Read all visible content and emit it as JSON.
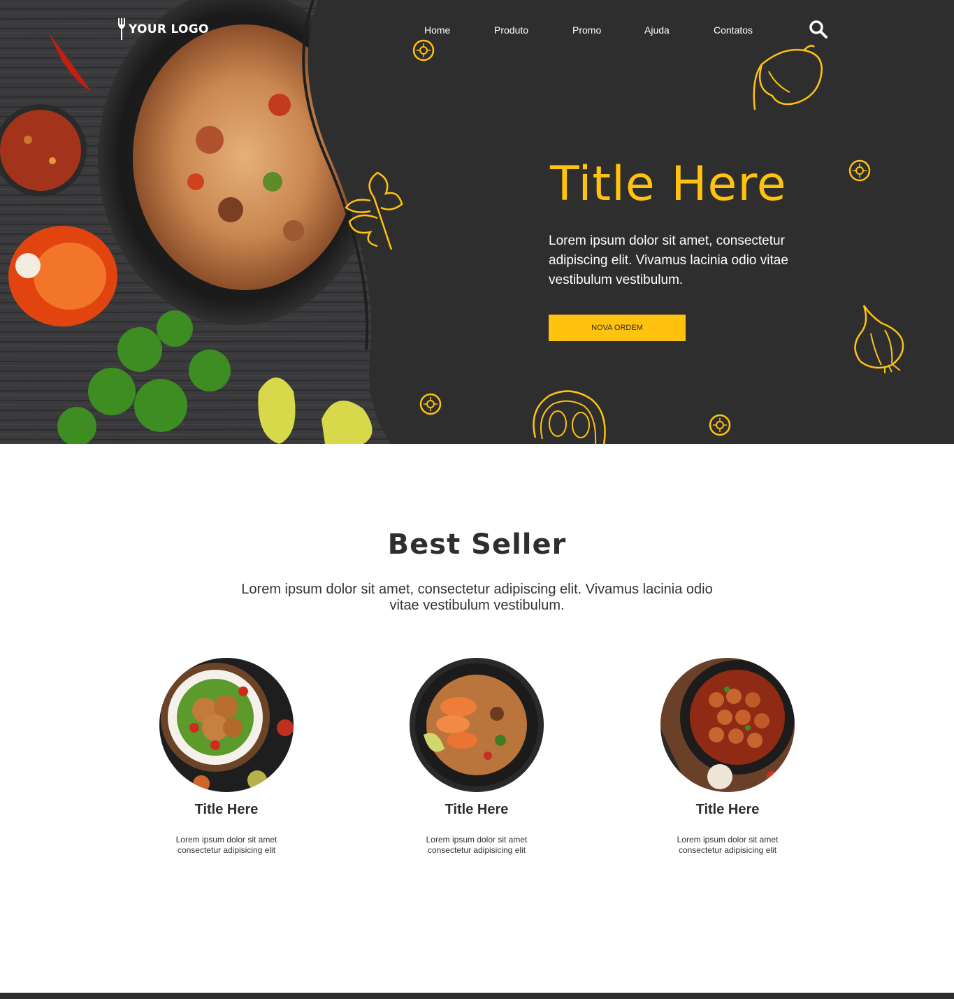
{
  "brand": {
    "logo_text": "YOUR LOGO",
    "accent": "#ffc20e",
    "dark": "#2e2e2e"
  },
  "nav": {
    "items": [
      "Home",
      "Produto",
      "Promo",
      "Ajuda",
      "Contatos"
    ],
    "search_icon": "search-icon"
  },
  "hero": {
    "title": "Title Here",
    "text": "Lorem ipsum dolor sit amet, consectetur adipiscing elit. Vivamus lacinia odio vitae vestibulum vestibulum.",
    "button_label": "NOVA ORDEM"
  },
  "best_seller": {
    "title": "Best Seller",
    "text": "Lorem ipsum dolor sit amet, consectetur adipiscing elit. Vivamus lacinia odio vitae vestibulum vestibulum.",
    "items": [
      {
        "title": "Title Here",
        "text": "Lorem ipsum dolor sit amet consectetur adipisicing elit",
        "image": "fried-chicken-plate"
      },
      {
        "title": "Title Here",
        "text": "Lorem ipsum dolor sit amet consectetur adipisicing elit",
        "image": "shrimp-noodles-bowl"
      },
      {
        "title": "Title Here",
        "text": "Lorem ipsum dolor sit amet consectetur adipisicing elit",
        "image": "meatballs-pan"
      }
    ]
  }
}
